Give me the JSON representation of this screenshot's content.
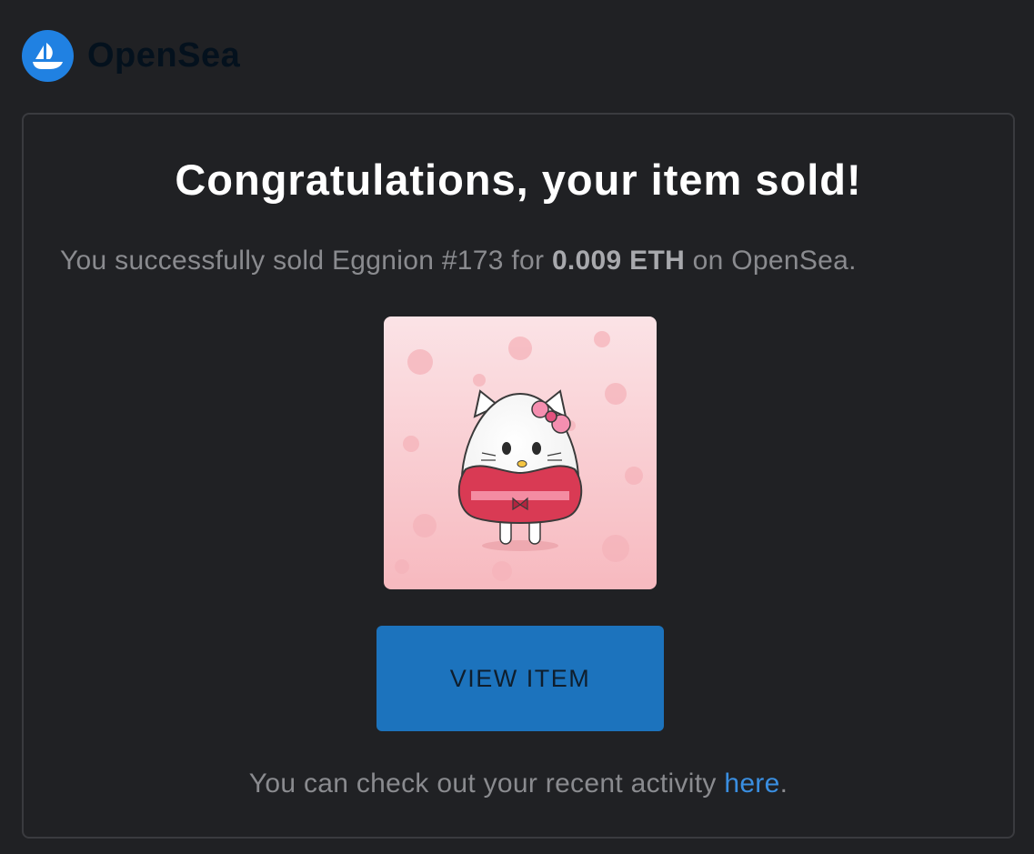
{
  "brand": {
    "name": "OpenSea",
    "logo_icon": "opensea-boat-icon",
    "logo_color": "#2081e2"
  },
  "email": {
    "title": "Congratulations, your item sold!",
    "subtitle": {
      "prefix": "You successfully sold Eggnion #173 for ",
      "price": "0.009 ETH",
      "suffix": " on OpenSea."
    },
    "item_image": {
      "subject": "cat-egg-character-in-pink-kimono"
    },
    "cta": {
      "label": "VIEW ITEM",
      "color": "#1c73bd"
    },
    "footer": {
      "prefix": "You can check out your recent activity ",
      "link_text": "here",
      "suffix": "."
    }
  }
}
